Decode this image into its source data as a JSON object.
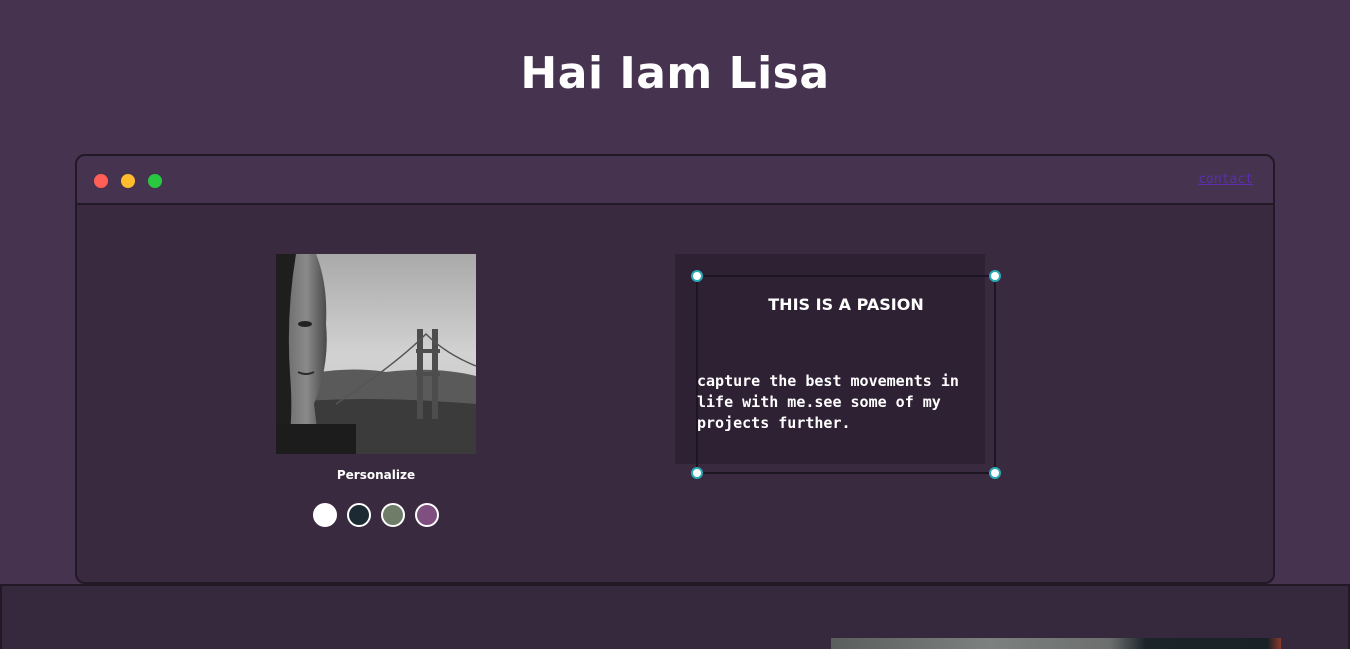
{
  "header": {
    "title": "Hai Iam Lisa"
  },
  "window": {
    "controls": [
      "close-dot",
      "minimize-dot",
      "maximize-dot"
    ],
    "contact_label": "contact"
  },
  "profile": {
    "photo_description_icon": "portrait-photo",
    "personalize_label": "Personalize",
    "swatch_colors": [
      "#ffffff",
      "#1c2b33",
      "#6f7d68",
      "#7e4f7f"
    ]
  },
  "passion": {
    "heading": "THIS IS A PASION",
    "text": "capture the best movements in life with me.see some of my projects further."
  },
  "colors": {
    "background": "#45334f",
    "window_body": "#3a2a40",
    "passion_box": "#2e2134",
    "link": "#5b2fb0",
    "handle_border": "#2aa9b5"
  }
}
